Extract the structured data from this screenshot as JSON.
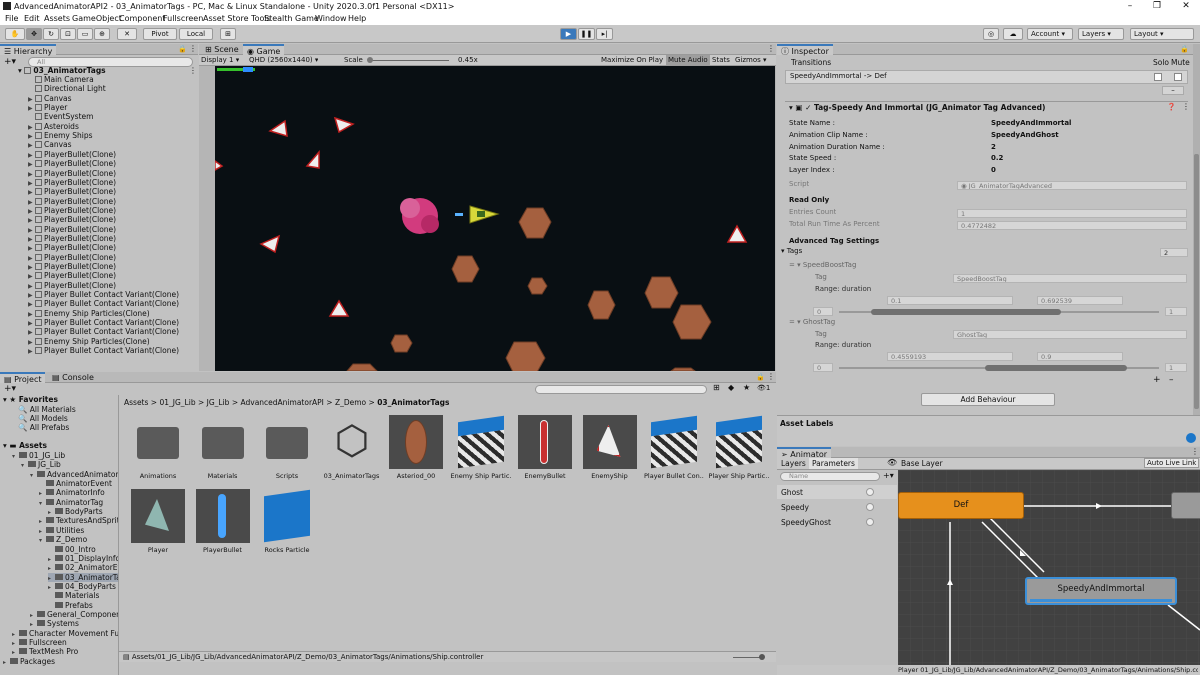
{
  "title_bar": {
    "title": "AdvancedAnimatorAPI2 - 03_AnimatorTags - PC, Mac & Linux Standalone - Unity 2020.3.0f1 Personal <DX11>"
  },
  "menu": [
    "File",
    "Edit",
    "Assets",
    "GameObject",
    "Component",
    "Fullscreen",
    "Asset Store Tools",
    "Stealth Game",
    "Window",
    "Help"
  ],
  "toolbar": {
    "pivot": "Pivot",
    "local": "Local",
    "account": "Account",
    "layers": "Layers",
    "layout": "Layout"
  },
  "hierarchy": {
    "tab": "Hierarchy",
    "search_placeholder": "All",
    "scene": "03_AnimatorTags",
    "items": [
      {
        "label": "Main Camera",
        "arrow": false
      },
      {
        "label": "Directional Light",
        "arrow": false
      },
      {
        "label": "Canvas",
        "arrow": true
      },
      {
        "label": "Player",
        "arrow": true
      },
      {
        "label": "EventSystem",
        "arrow": false
      },
      {
        "label": "Asteroids",
        "arrow": true
      },
      {
        "label": "Enemy Ships",
        "arrow": true
      },
      {
        "label": "Canvas",
        "arrow": true
      },
      {
        "label": "PlayerBullet(Clone)",
        "arrow": true
      },
      {
        "label": "PlayerBullet(Clone)",
        "arrow": true
      },
      {
        "label": "PlayerBullet(Clone)",
        "arrow": true
      },
      {
        "label": "PlayerBullet(Clone)",
        "arrow": true
      },
      {
        "label": "PlayerBullet(Clone)",
        "arrow": true
      },
      {
        "label": "PlayerBullet(Clone)",
        "arrow": true
      },
      {
        "label": "PlayerBullet(Clone)",
        "arrow": true
      },
      {
        "label": "PlayerBullet(Clone)",
        "arrow": true
      },
      {
        "label": "PlayerBullet(Clone)",
        "arrow": true
      },
      {
        "label": "PlayerBullet(Clone)",
        "arrow": true
      },
      {
        "label": "PlayerBullet(Clone)",
        "arrow": true
      },
      {
        "label": "PlayerBullet(Clone)",
        "arrow": true
      },
      {
        "label": "PlayerBullet(Clone)",
        "arrow": true
      },
      {
        "label": "PlayerBullet(Clone)",
        "arrow": true
      },
      {
        "label": "PlayerBullet(Clone)",
        "arrow": true
      },
      {
        "label": "Player Bullet Contact Variant(Clone)",
        "arrow": true
      },
      {
        "label": "Player Bullet Contact Variant(Clone)",
        "arrow": true
      },
      {
        "label": "Enemy Ship Particles(Clone)",
        "arrow": true
      },
      {
        "label": "Player Bullet Contact Variant(Clone)",
        "arrow": true
      },
      {
        "label": "Player Bullet Contact Variant(Clone)",
        "arrow": true
      },
      {
        "label": "Enemy Ship Particles(Clone)",
        "arrow": true
      },
      {
        "label": "Player Bullet Contact Variant(Clone)",
        "arrow": true
      }
    ]
  },
  "scene_tabs": {
    "scene": "Scene",
    "game": "Game"
  },
  "game_bar": {
    "display": "Display 1",
    "resolution": "QHD (2560x1440)",
    "scale_label": "Scale",
    "scale_value": "0.45x",
    "maximize": "Maximize On Play",
    "mute": "Mute Audio",
    "stats": "Stats",
    "gizmos": "Gizmos"
  },
  "inspector": {
    "tab": "Inspector",
    "transitions_label": "Transitions",
    "solo_label": "Solo",
    "mute_label": "Mute",
    "transition": "SpeedyAndImmortal -> Def",
    "component_title": "Tag-Speedy And Immortal (JG_Animator Tag Advanced)",
    "props": [
      {
        "label": "State Name :",
        "value": "SpeedyAndImmortal"
      },
      {
        "label": "Animation Clip Name :",
        "value": "SpeedyAndGhost"
      },
      {
        "label": "Animation Duration Name :",
        "value": "2"
      },
      {
        "label": "State Speed :",
        "value": "0.2"
      },
      {
        "label": "Layer Index :",
        "value": "0"
      }
    ],
    "script_label": "Script",
    "script_value": "JG_AnimatorTagAdvanced",
    "readonly_label": "Read Only",
    "entries_label": "Entries Count",
    "entries_value": "1",
    "runtime_label": "Total Run Time As Percent",
    "runtime_value": "0.4772482",
    "advanced_label": "Advanced Tag Settings",
    "tags_label": "Tags",
    "tags_count": "2",
    "tag1": {
      "name": "SpeedBoostTag",
      "tag_label": "Tag",
      "tag_value": "SpeedBoostTag",
      "range_label": "Range: duration",
      "min": "0.1",
      "max": "0.692539",
      "lo": "0",
      "hi": "1",
      "range_start": 0.1,
      "range_end": 0.692539
    },
    "tag2": {
      "name": "GhostTag",
      "tag_label": "Tag",
      "tag_value": "GhostTag",
      "range_label": "Range: duration",
      "min": "0.4559193",
      "max": "0.9",
      "lo": "0",
      "hi": "1",
      "range_start": 0.4559193,
      "range_end": 0.9
    },
    "add_behaviour": "Add Behaviour",
    "asset_labels": "Asset Labels"
  },
  "project": {
    "tab_project": "Project",
    "tab_console": "Console",
    "favorites": "Favorites",
    "fav_items": [
      "All Materials",
      "All Models",
      "All Prefabs"
    ],
    "assets_root": "Assets",
    "tree": [
      {
        "label": "01_JG_Lib",
        "indent": 1,
        "arrow": "v"
      },
      {
        "label": "JG_Lib",
        "indent": 2,
        "arrow": "v"
      },
      {
        "label": "AdvancedAnimatorA",
        "indent": 3,
        "arrow": "v"
      },
      {
        "label": "AnimatorEvent",
        "indent": 4,
        "arrow": ""
      },
      {
        "label": "AnimatorInfo",
        "indent": 4,
        "arrow": ">"
      },
      {
        "label": "AnimatorTag",
        "indent": 4,
        "arrow": "v"
      },
      {
        "label": "BodyParts",
        "indent": 5,
        "arrow": ">"
      },
      {
        "label": "TexturesAndSprite",
        "indent": 4,
        "arrow": ">"
      },
      {
        "label": "Utilities",
        "indent": 4,
        "arrow": ">"
      },
      {
        "label": "Z_Demo",
        "indent": 4,
        "arrow": "v"
      },
      {
        "label": "00_Intro",
        "indent": 5,
        "arrow": ""
      },
      {
        "label": "01_DisplayInfoF",
        "indent": 5,
        "arrow": ">"
      },
      {
        "label": "02_AnimatorEve",
        "indent": 5,
        "arrow": ">"
      },
      {
        "label": "03_AnimatorTa",
        "indent": 5,
        "arrow": ">"
      },
      {
        "label": "04_BodyParts",
        "indent": 5,
        "arrow": ">"
      },
      {
        "label": "Materials",
        "indent": 5,
        "arrow": ""
      },
      {
        "label": "Prefabs",
        "indent": 5,
        "arrow": ""
      },
      {
        "label": "General_Component",
        "indent": 3,
        "arrow": ">"
      },
      {
        "label": "Systems",
        "indent": 3,
        "arrow": ">"
      },
      {
        "label": "Character Movement Fun",
        "indent": 1,
        "arrow": ">"
      },
      {
        "label": "Fullscreen",
        "indent": 1,
        "arrow": ">"
      },
      {
        "label": "TextMesh Pro",
        "indent": 1,
        "arrow": ">"
      },
      {
        "label": "Packages",
        "indent": 0,
        "arrow": ">"
      }
    ],
    "breadcrumb": [
      "Assets",
      "01_JG_Lib",
      "JG_Lib",
      "AdvancedAnimatorAPI",
      "Z_Demo",
      "03_AnimatorTags"
    ],
    "assets": [
      {
        "label": "Animations",
        "kind": "folder"
      },
      {
        "label": "Materials",
        "kind": "folder"
      },
      {
        "label": "Scripts",
        "kind": "folder"
      },
      {
        "label": "03_AnimatorTags",
        "kind": "unity"
      },
      {
        "label": "Asteriod_00",
        "kind": "asteroid"
      },
      {
        "label": "Enemy Ship Partic...",
        "kind": "cube-striped"
      },
      {
        "label": "EnemyBullet",
        "kind": "bullet-red"
      },
      {
        "label": "EnemyShip",
        "kind": "ship"
      },
      {
        "label": "Player Bullet Con...",
        "kind": "cube-striped"
      },
      {
        "label": "Player Ship Partic...",
        "kind": "cube-striped"
      },
      {
        "label": "Player",
        "kind": "player"
      },
      {
        "label": "PlayerBullet",
        "kind": "bullet-blue"
      },
      {
        "label": "Rocks Particle",
        "kind": "cube"
      }
    ],
    "status_path": "Assets/01_JG_Lib/JG_Lib/AdvancedAnimatorAPI/Z_Demo/03_AnimatorTags/Animations/Ship.controller",
    "asset_count": "1"
  },
  "animator": {
    "tab": "Animator",
    "layers_tab": "Layers",
    "params_tab": "Parameters",
    "base_layer": "Base Layer",
    "auto_live": "Auto Live Link",
    "search_placeholder": "Name",
    "params": [
      "Ghost",
      "Speedy",
      "SpeedyGhost"
    ],
    "state_default": "Def",
    "state_active": "SpeedyAndImmortal",
    "status_path": "Player 01_JG_Lib/JG_Lib/AdvancedAnimatorAPI/Z_Demo/03_AnimatorTags/Animations/Ship.controller"
  },
  "colors": {
    "accent": "#3a79bb",
    "state_default": "#e6901c",
    "state_active_bar": "#3b8fd8",
    "game_bg": "#090f13",
    "graph_bg": "#414141"
  }
}
